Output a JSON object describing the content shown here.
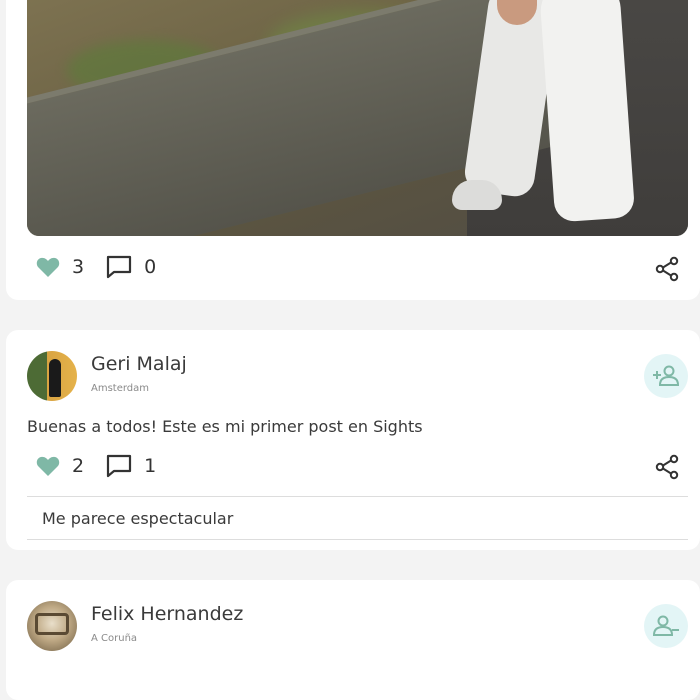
{
  "posts": [
    {
      "likes": "3",
      "comments": "0"
    },
    {
      "author": "Geri Malaj",
      "location": "Amsterdam",
      "text": "Buenas a todos! Este es mi primer post en Sights",
      "likes": "2",
      "comments": "1",
      "top_comment": "Me parece espectacular",
      "follow_action": "add-user"
    },
    {
      "author": "Felix Hernandez",
      "location": "A Coruña",
      "follow_action": "remove-user"
    }
  ],
  "colors": {
    "accent": "#7fb8a6",
    "follow_bg": "#e3f5f6",
    "card_bg": "#ffffff",
    "page_bg": "#f3f3f3"
  },
  "icons": [
    "heart-icon",
    "comment-icon",
    "share-icon",
    "add-user-icon",
    "remove-user-icon"
  ]
}
